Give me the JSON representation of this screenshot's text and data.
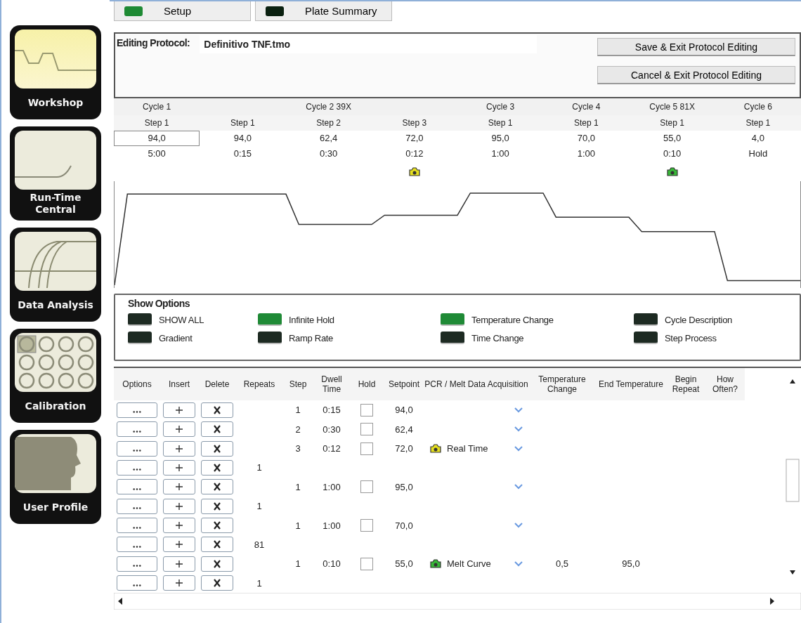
{
  "nav": [
    {
      "label": "Workshop",
      "selected": true
    },
    {
      "label": "Run-Time Central",
      "selected": false
    },
    {
      "label": "Data Analysis",
      "selected": false
    },
    {
      "label": "Calibration",
      "selected": false
    },
    {
      "label": "User Profile",
      "selected": false
    }
  ],
  "tabs": [
    {
      "label": "Setup",
      "selected": true
    },
    {
      "label": "Plate Summary",
      "selected": false
    }
  ],
  "editor": {
    "label": "Editing Protocol:",
    "file": "Definitivo TNF.tmo",
    "buttons": [
      "Save & Exit Protocol Editing",
      "Cancel & Exit Protocol Editing"
    ]
  },
  "cycles": [
    {
      "label": "Cycle 1",
      "steps": [
        {
          "label": "Step 1",
          "setpoint": "94,0",
          "time": "5:00",
          "selected": true
        }
      ]
    },
    {
      "label": "Cycle 2 39X",
      "steps": [
        {
          "label": "Step 1",
          "setpoint": "94,0",
          "time": "0:15",
          "selected": false
        },
        {
          "label": "Step 2",
          "setpoint": "62,4",
          "time": "0:30",
          "selected": false
        },
        {
          "label": "Step 3",
          "setpoint": "72,0",
          "time": "0:12",
          "color": "#e6e020",
          "selected": false
        }
      ]
    },
    {
      "label": "Cycle 3",
      "steps": [
        {
          "label": "Step 1",
          "setpoint": "95,0",
          "time": "1:00",
          "selected": false
        }
      ]
    },
    {
      "label": "Cycle 4",
      "steps": [
        {
          "label": "Step 1",
          "setpoint": "70,0",
          "time": "1:00",
          "selected": false
        }
      ]
    },
    {
      "label": "Cycle 5 81X",
      "steps": [
        {
          "label": "Step 1",
          "setpoint": "55,0",
          "time": "0:10",
          "color": "#38b838",
          "selected": false
        }
      ]
    },
    {
      "label": "Cycle 6",
      "steps": [
        {
          "label": "Step 1",
          "setpoint": "4,0",
          "time": "Hold",
          "selected": false
        }
      ]
    }
  ],
  "show_options": {
    "title": "Show Options",
    "options": [
      {
        "label": "SHOW ALL",
        "on": false
      },
      {
        "label": "Infinite Hold",
        "on": true
      },
      {
        "label": "Temperature Change",
        "on": true
      },
      {
        "label": "Cycle Description",
        "on": false
      },
      {
        "label": "Gradient",
        "on": false
      },
      {
        "label": "Ramp Rate",
        "on": false
      },
      {
        "label": "Time Change",
        "on": false
      },
      {
        "label": "Step Process",
        "on": false
      }
    ]
  },
  "table": {
    "columns": [
      "Options",
      "Insert",
      "Delete",
      "Repeats",
      "Step",
      "Dwell Time",
      "Hold",
      "Setpoint",
      "PCR / Melt Data Acquisition",
      "Temperature Change",
      "End Temperature",
      "Begin Repeat",
      "How Often?"
    ],
    "rows": [
      {
        "kind": "step",
        "step": "1",
        "dwell": "0:15",
        "hold": false,
        "setpoint": "94,0"
      },
      {
        "kind": "step",
        "step": "2",
        "dwell": "0:30",
        "hold": false,
        "setpoint": "62,4"
      },
      {
        "kind": "step",
        "step": "3",
        "dwell": "0:12",
        "hold": false,
        "setpoint": "72,0",
        "acquisition": {
          "color": "#e6e020",
          "label": "Real Time"
        }
      },
      {
        "kind": "repeat",
        "repeats": "1"
      },
      {
        "kind": "step",
        "step": "1",
        "dwell": "1:00",
        "hold": false,
        "setpoint": "95,0"
      },
      {
        "kind": "repeat",
        "repeats": "1"
      },
      {
        "kind": "step",
        "step": "1",
        "dwell": "1:00",
        "hold": false,
        "setpoint": "70,0"
      },
      {
        "kind": "repeat",
        "repeats": "81"
      },
      {
        "kind": "step",
        "step": "1",
        "dwell": "0:10",
        "hold": false,
        "setpoint": "55,0",
        "acquisition": {
          "color": "#38b838",
          "label": "Melt Curve"
        },
        "temperature_change": "0,5",
        "end_temperature": "95,0"
      },
      {
        "kind": "repeat",
        "repeats": "1"
      }
    ]
  }
}
